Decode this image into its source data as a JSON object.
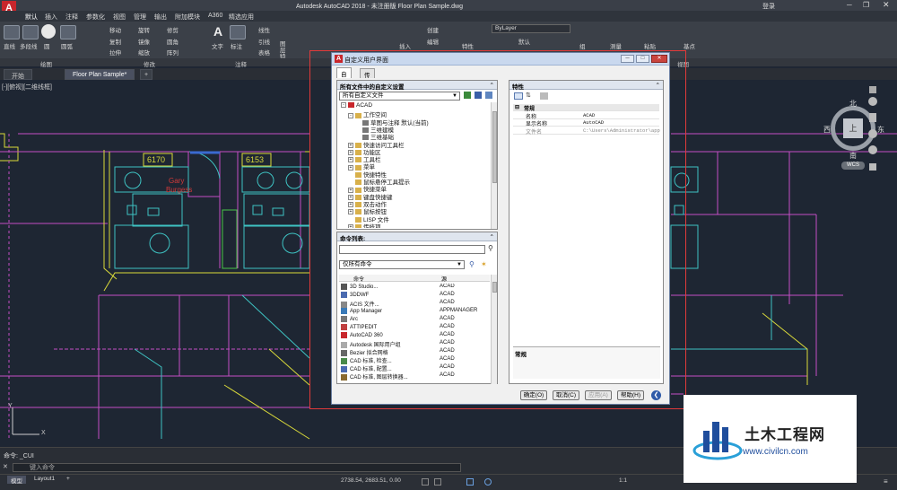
{
  "app": {
    "title": "Autodesk AutoCAD 2018 - 未注册版    Floor Plan Sample.dwg",
    "logo": "A",
    "login_label": "登录"
  },
  "menubar": {
    "items": [
      "默认",
      "插入",
      "注释",
      "参数化",
      "视图",
      "管理",
      "输出",
      "附加模块",
      "A360",
      "精选应用"
    ]
  },
  "ribbon": {
    "draw": [
      "直线",
      "多段线",
      "圆",
      "圆弧"
    ],
    "modify": [
      "移动",
      "旋转",
      "修剪",
      "复制",
      "镜像",
      "圆角",
      "拉伸",
      "缩放",
      "阵列"
    ],
    "annotation": [
      "文字",
      "标注",
      "线性",
      "引线",
      "表格"
    ],
    "layers": [
      "图层特性"
    ],
    "block": [
      "插入",
      "创建",
      "编辑"
    ],
    "properties_label": "特性",
    "bylayer": "ByLayer",
    "default_label": "默认",
    "group_label": "组",
    "measure_label": "测量",
    "paste_label": "粘贴",
    "base_label": "基点",
    "panels": [
      "绘图",
      "修改",
      "注释",
      "视图"
    ]
  },
  "filetabs": {
    "start": "开始",
    "current": "Floor Plan Sample*",
    "add": "+"
  },
  "viewport": {
    "label": "[-][俯视][二维线框]",
    "room1": "6170",
    "room2": "6153",
    "person_first": "Gary",
    "person_last": "Burgess"
  },
  "viewcube": {
    "north": "北",
    "south": "南",
    "east": "东",
    "west": "西",
    "top": "上",
    "wcs": "WCS"
  },
  "dialog": {
    "title": "自定义用户界面",
    "tabs": [
      "自定义",
      "传输"
    ],
    "left_pane_title": "所有文件中的自定义设置",
    "file_filter": "所有自定义文件",
    "tree": [
      {
        "label": "ACAD",
        "level": 0,
        "exp": "-"
      },
      {
        "label": "工作空间",
        "level": 1,
        "exp": "-"
      },
      {
        "label": "草图与注释 默认(当前)",
        "level": 2,
        "exp": ""
      },
      {
        "label": "三维建模",
        "level": 2,
        "exp": ""
      },
      {
        "label": "三维基础",
        "level": 2,
        "exp": ""
      },
      {
        "label": "快速访问工具栏",
        "level": 1,
        "exp": "+"
      },
      {
        "label": "功能区",
        "level": 1,
        "exp": "+"
      },
      {
        "label": "工具栏",
        "level": 1,
        "exp": "+"
      },
      {
        "label": "菜单",
        "level": 1,
        "exp": "+"
      },
      {
        "label": "快捷特性",
        "level": 1,
        "exp": ""
      },
      {
        "label": "鼠标悬停工具提示",
        "level": 1,
        "exp": ""
      },
      {
        "label": "快捷菜单",
        "level": 1,
        "exp": "+"
      },
      {
        "label": "键盘快捷键",
        "level": 1,
        "exp": "+"
      },
      {
        "label": "双击动作",
        "level": 1,
        "exp": "+"
      },
      {
        "label": "鼠标按钮",
        "level": 1,
        "exp": "+"
      },
      {
        "label": "LISP 文件",
        "level": 1,
        "exp": ""
      },
      {
        "label": "传统项",
        "level": 1,
        "exp": "+"
      }
    ],
    "cmd_pane_title": "命令列表:",
    "cmd_filter": "仅所有命令",
    "cmd_col_name": "命令",
    "cmd_col_src": "源",
    "commands": [
      {
        "name": "3D Studio...",
        "src": "ACAD"
      },
      {
        "name": "3DDWF",
        "src": "ACAD"
      },
      {
        "name": "ACIS 文件...",
        "src": "ACAD"
      },
      {
        "name": "App Manager",
        "src": "APPMANAGER"
      },
      {
        "name": "Arc",
        "src": "ACAD"
      },
      {
        "name": "ATTIPEDIT",
        "src": "ACAD"
      },
      {
        "name": "AutoCAD 360",
        "src": "ACAD"
      },
      {
        "name": "Autodesk 国际用户组",
        "src": "ACAD"
      },
      {
        "name": "Bezier 拟合网格",
        "src": "ACAD"
      },
      {
        "name": "CAD 标准, 检查...",
        "src": "ACAD"
      },
      {
        "name": "CAD 标准, 配置...",
        "src": "ACAD"
      },
      {
        "name": "CAD 标准, 图层转换器...",
        "src": "ACAD"
      }
    ],
    "right_pane_title": "特性",
    "prop_group": "常规",
    "props": [
      {
        "k": "名称",
        "v": "ACAD"
      },
      {
        "k": "显示名称",
        "v": "AutoCAD"
      },
      {
        "k": "文件名",
        "v": "C:\\Users\\Administrator\\app"
      }
    ],
    "desc_title": "常规",
    "buttons": {
      "ok": "确定(O)",
      "cancel": "取消(C)",
      "apply": "应用(A)",
      "help": "帮助(H)"
    }
  },
  "command": {
    "history": "命令: _CUI",
    "prompt": "键入命令"
  },
  "status": {
    "model": "模型",
    "layout": "Layout1",
    "coords": "2738.54, 2683.51, 0.00",
    "scale": "1:1"
  },
  "watermark": {
    "name": "土木工程网",
    "url": "www.civilcn.com"
  }
}
